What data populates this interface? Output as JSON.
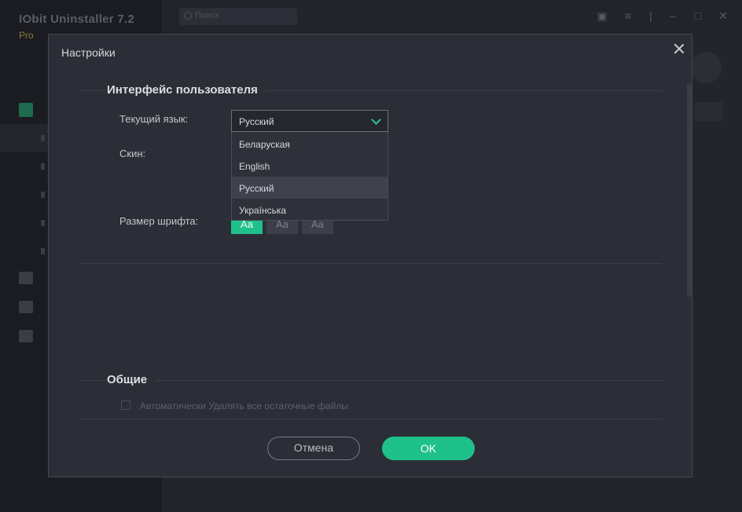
{
  "background_app": {
    "title": "IObit Uninstaller 7.2",
    "edition": "Pro",
    "search_placeholder": "Поиск"
  },
  "dialog": {
    "title": "Настройки",
    "ui_section": {
      "heading": "Интерфейс пользователя",
      "language_label": "Текущий язык:",
      "language_value": "Русский",
      "language_options": [
        "Беларуская",
        "English",
        "Русский",
        "Українська"
      ],
      "highlighted_option": "Русский",
      "skin_label": "Скин:",
      "font_size_label": "Размер шрифта:",
      "font_sizes": [
        "Aa",
        "Aa",
        "Aa"
      ],
      "selected_font_size": 0
    },
    "general_section": {
      "heading": "Общие",
      "auto_delete_label": "Автоматически Удалять все остаточные файлы",
      "auto_delete_checked": false
    },
    "buttons": {
      "cancel": "Отмена",
      "ok": "OK"
    }
  },
  "colors": {
    "accent": "#1fc18a",
    "dialog_bg": "#2b2e37",
    "app_bg": "#1d1f26"
  }
}
